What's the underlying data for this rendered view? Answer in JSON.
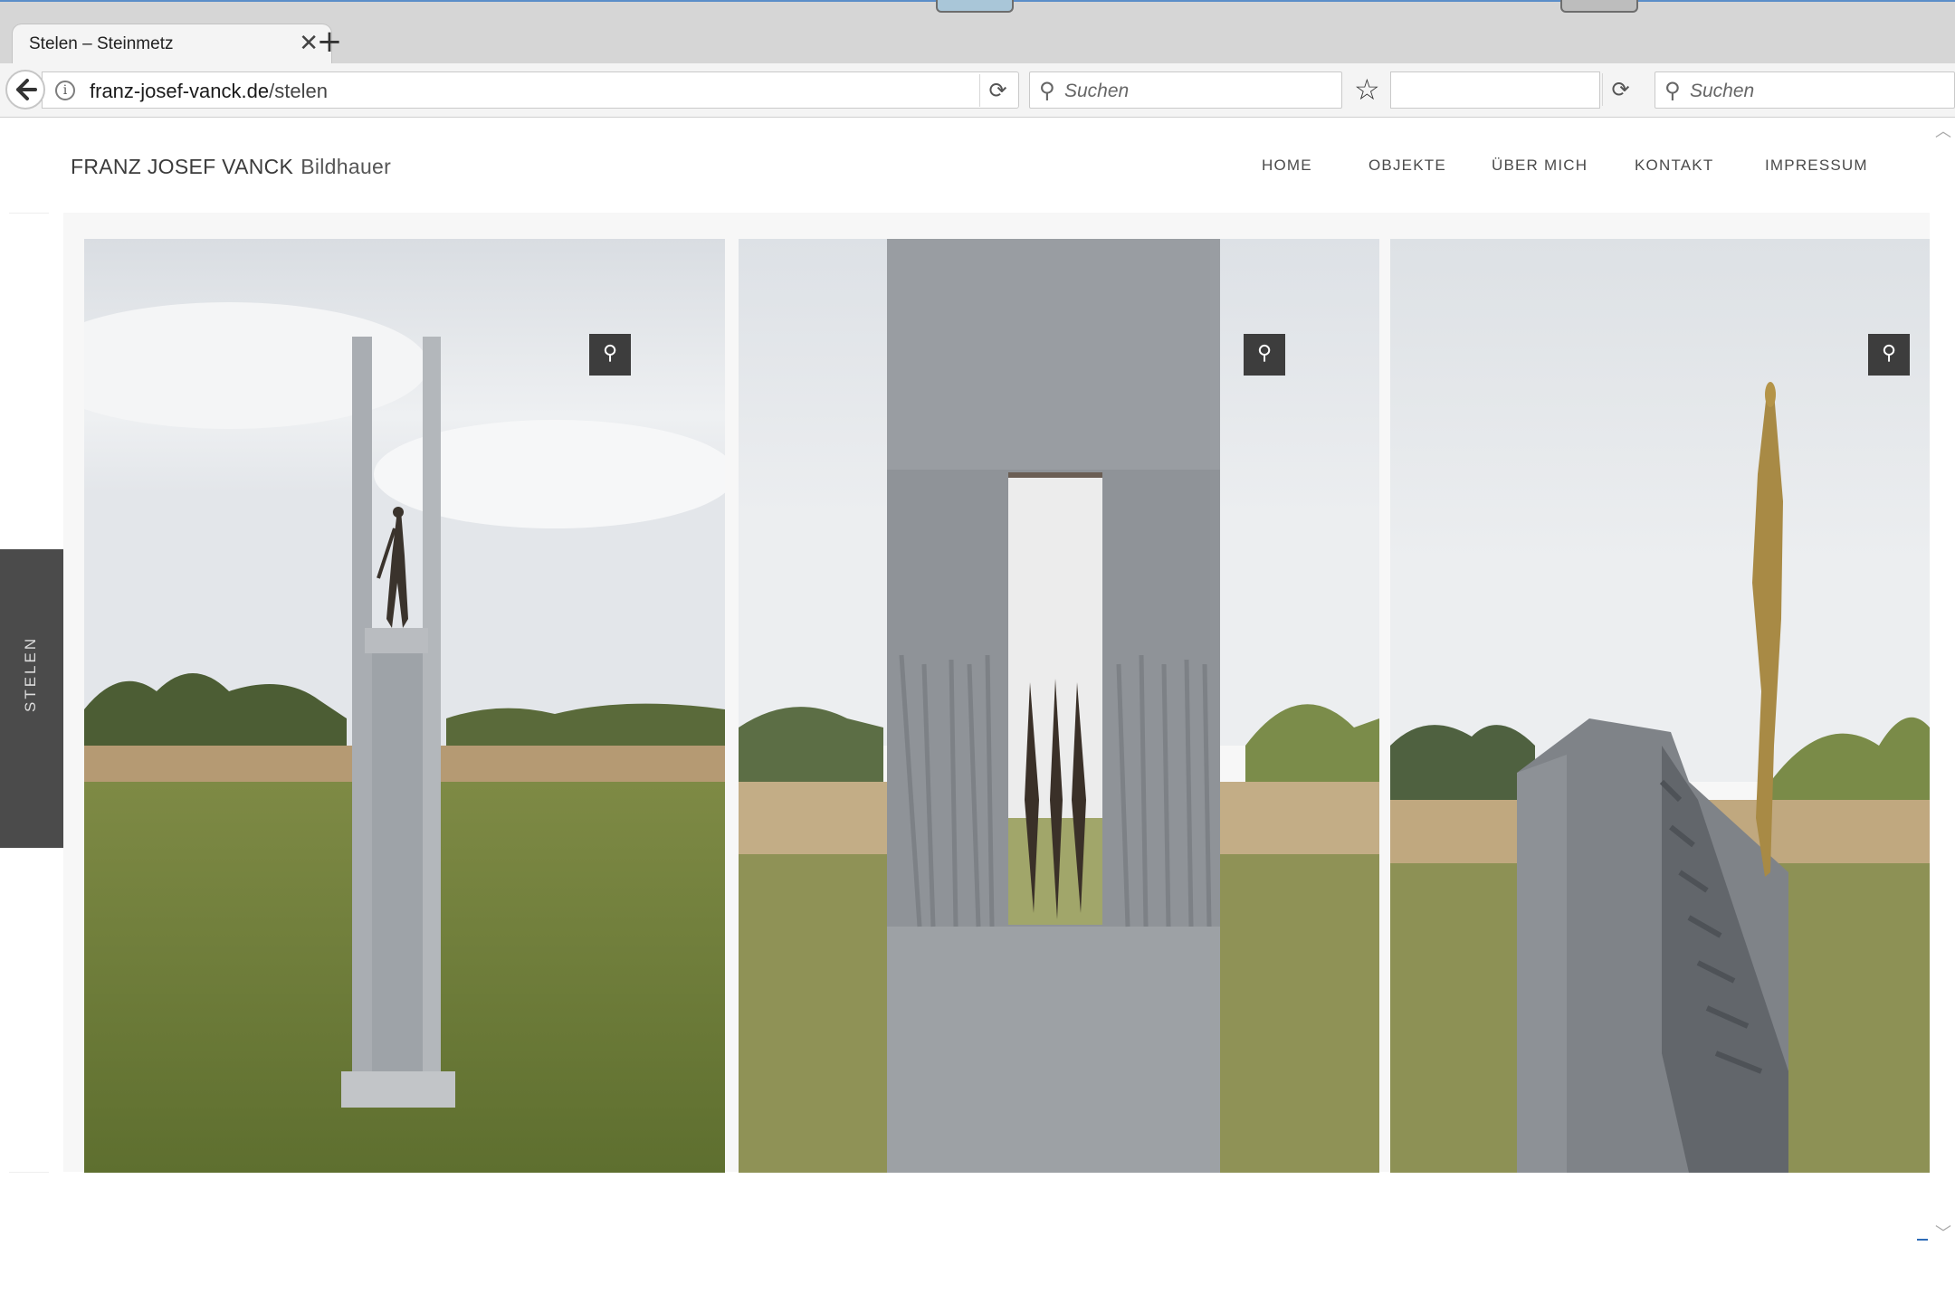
{
  "browser": {
    "tab_title": "Stelen – Steinmetz",
    "tab_close": "✕",
    "new_tab": "+",
    "url_domain": "franz-josef-vanck.de",
    "url_separator": "/",
    "url_path": "stelen",
    "search_placeholder": "Suchen",
    "search_placeholder_2": "Suchen"
  },
  "site": {
    "brand_name": "FRANZ JOSEF VANCK",
    "brand_sub": "Bildhauer",
    "nav": [
      "HOME",
      "OBJEKTE",
      "ÜBER MICH",
      "KONTAKT",
      "IMPRESSUM"
    ],
    "side_tab_label": "STELEN"
  },
  "gallery": {
    "items": [
      {
        "icon": "magnifier-icon"
      },
      {
        "icon": "magnifier-icon"
      },
      {
        "icon": "magnifier-icon"
      }
    ]
  },
  "colors": {
    "accent_blue": "#5b8ec9",
    "side_tab": "#4b4b4b",
    "zoom_button": "#3d3d3d"
  }
}
